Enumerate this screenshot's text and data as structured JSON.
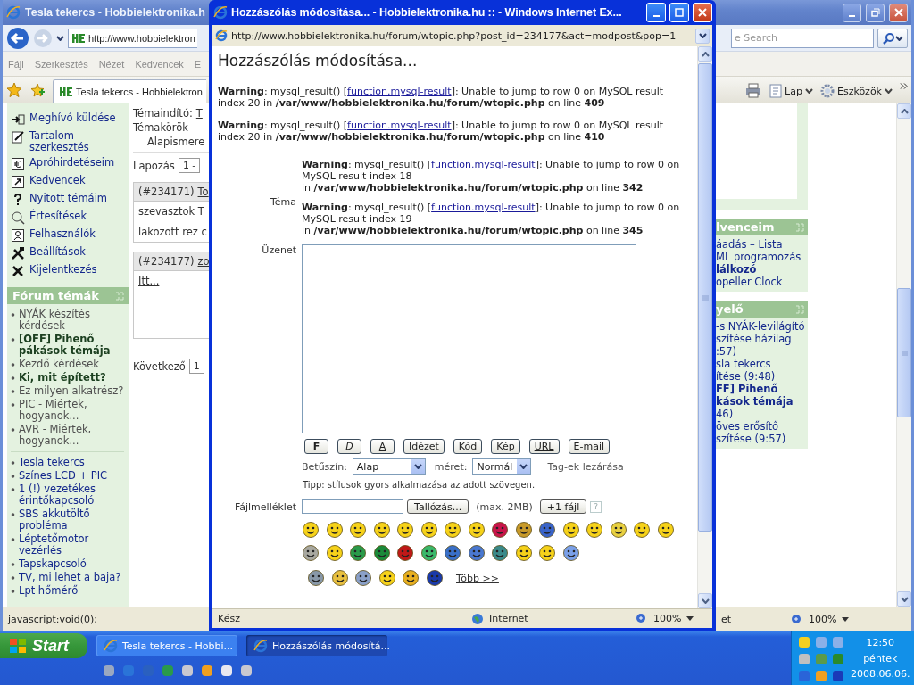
{
  "browser": {
    "title": "Tesla tekercs - Hobbielektronika.h",
    "address": "http://www.hobbielektron",
    "search_placeholder": "e Search",
    "menu": [
      "Fájl",
      "Szerkesztés",
      "Nézet",
      "Kedvencek",
      "E"
    ],
    "tab": "Tesla tekercs - Hobbielektron",
    "tools": [
      "Lap",
      "Eszközök"
    ],
    "status": "javascript:void(0);",
    "status_zone": "et",
    "zoom": "100%"
  },
  "sidebar": {
    "menu": [
      "Meghívó küldése",
      "Tartalom szerkesztés",
      "Apróhirdetéseim",
      "Kedvencek",
      "Nyitott témáim",
      "Értesítések",
      "Felhasználók",
      "Beállítások",
      "Kijelentkezés"
    ],
    "forum_title": "Fórum témák",
    "forum_topics": [
      {
        "label": "NYÁK készítés kérdések",
        "bold": false
      },
      {
        "label": "[OFF] Pihenő pákások témája",
        "bold": true
      },
      {
        "label": "Kezdő kérdések",
        "bold": false
      },
      {
        "label": "Ki, mit épített?",
        "bold": true
      },
      {
        "label": "Ez milyen alkatrész?",
        "bold": false
      },
      {
        "label": "PIC - Miértek, hogyanok...",
        "bold": false
      },
      {
        "label": "AVR - Miértek, hogyanok...",
        "bold": false
      }
    ],
    "recent_topics": [
      "Tesla tekercs",
      "Színes LCD + PIC",
      "1 (!) vezetékes érintőkapcsoló",
      "SBS akkutöltő probléma",
      "Léptetőmotor vezérlés",
      "Tapskapcsoló",
      "TV, mi lehet a baja?",
      "Lpt hőmérő"
    ]
  },
  "topic_view": {
    "starter_label": "Témaindító:",
    "starter": "T",
    "category_label": "Témakörök",
    "category": "Alapismere",
    "paging_label": "Lapozás",
    "paging_value": "1 -",
    "posts": [
      {
        "number": "(#234171)",
        "author": "To",
        "lines": [
          "szevasztok T",
          "lakozott rez c"
        ]
      },
      {
        "number": "(#234177)",
        "author": "zo",
        "lines": [
          "Itt..."
        ]
      }
    ],
    "next_label": "Következő",
    "next_value": "1"
  },
  "right_boxes": [
    {
      "title": "lvenceim",
      "lines": [
        {
          "text": "áadás – Lista",
          "bold": false
        },
        {
          "text": "ML programozás",
          "bold": false
        },
        {
          "text": "lálkozó",
          "bold": true
        },
        {
          "text": "opeller Clock",
          "bold": false
        }
      ]
    },
    {
      "title": "yelő",
      "lines": [
        {
          "text": "-s NYÁK-levilágító",
          "bold": false
        },
        {
          "text": "szítése házilag",
          "bold": false
        },
        {
          "text": ":57)",
          "bold": false
        },
        {
          "text": "sla tekercs",
          "bold": false
        },
        {
          "text": "ítése (9:48)",
          "bold": false
        },
        {
          "text": "FF] Pihenő",
          "bold": true
        },
        {
          "text": "kások témája",
          "bold": true
        },
        {
          "text": "46)",
          "bold": false
        },
        {
          "text": "öves erősítő",
          "bold": false
        },
        {
          "text": "szítése (9:57)",
          "bold": false
        }
      ]
    }
  ],
  "popup": {
    "title": "Hozzászólás módosítása... - Hobbielektronika.hu :: - Windows Internet Ex...",
    "address": "http://www.hobbielektronika.hu/forum/wtopic.php?post_id=234177&act=modpost&pop=1",
    "heading": "Hozzászólás módosítása...",
    "warnings": [
      {
        "kind": "page",
        "label": "Warning",
        "before_link": ": mysql_result() [",
        "link": "function.mysql-result",
        "after_link": "]: Unable to jump to row 0 on MySQL result index 20",
        "path_prefix": " in ",
        "path": "/var/www/hobbielektronika.hu/forum/wtopic.php",
        "line_prefix": " on line ",
        "line": "409"
      },
      {
        "kind": "page",
        "label": "Warning",
        "before_link": ": mysql_result() [",
        "link": "function.mysql-result",
        "after_link": "]: Unable to jump to row 0 on MySQL result index 20",
        "path_prefix": " in ",
        "path": "/var/www/hobbielektronika.hu/forum/wtopic.php",
        "line_prefix": " on line ",
        "line": "410"
      }
    ],
    "topic_label": "Téma",
    "topic_warnings": [
      {
        "kind": "field",
        "label": "Warning",
        "before_link": ": mysql_result() [",
        "link": "function.mysql-result",
        "after_link": "]: Unable to jump to row 0 on MySQL result index 18",
        "path_prefix": "in ",
        "path": "/var/www/hobbielektronika.hu/forum/wtopic.php",
        "line_prefix": " on line ",
        "line": "342"
      },
      {
        "kind": "field",
        "label": "Warning",
        "before_link": ": mysql_result() [",
        "link": "function.mysql-result",
        "after_link": "]: Unable to jump to row 0 on MySQL result index 19",
        "path_prefix": "in ",
        "path": "/var/www/hobbielektronika.hu/forum/wtopic.php",
        "line_prefix": " on line ",
        "line": "345"
      }
    ],
    "message_label": "Üzenet",
    "format_buttons": [
      {
        "label": "F",
        "kind": "bold"
      },
      {
        "label": "D",
        "kind": "italic"
      },
      {
        "label": "A",
        "kind": "underline"
      },
      {
        "label": "Idézet",
        "kind": "plain"
      },
      {
        "label": "Kód",
        "kind": "plain"
      },
      {
        "label": "Kép",
        "kind": "plain"
      },
      {
        "label": "URL",
        "kind": "underline"
      },
      {
        "label": "E-mail",
        "kind": "plain"
      }
    ],
    "color_label": "Betűszín:",
    "color_value": "Alap",
    "size_label": "méret:",
    "size_value": "Normál",
    "close_tags": "Tag-ek lezárása",
    "tip": "Tipp: stílusok gyors alkalmazása az adott szövegen.",
    "attachment_label": "Fájlmelléklet",
    "browse": "Tallózás...",
    "max_size": "(max. 2MB)",
    "add_file": "+1 fájl",
    "help": "?",
    "more_smileys": "Több >>",
    "status": "Kész",
    "zone": "Internet",
    "zoom": "100%"
  },
  "taskbar": {
    "start": "Start",
    "tasks": [
      {
        "label": "Tesla tekercs - Hobbi...",
        "selected": false
      },
      {
        "label": "Hozzászólás módosítá...",
        "selected": true
      }
    ],
    "time": "12:50",
    "day": "péntek",
    "date": "2008.06.06."
  }
}
